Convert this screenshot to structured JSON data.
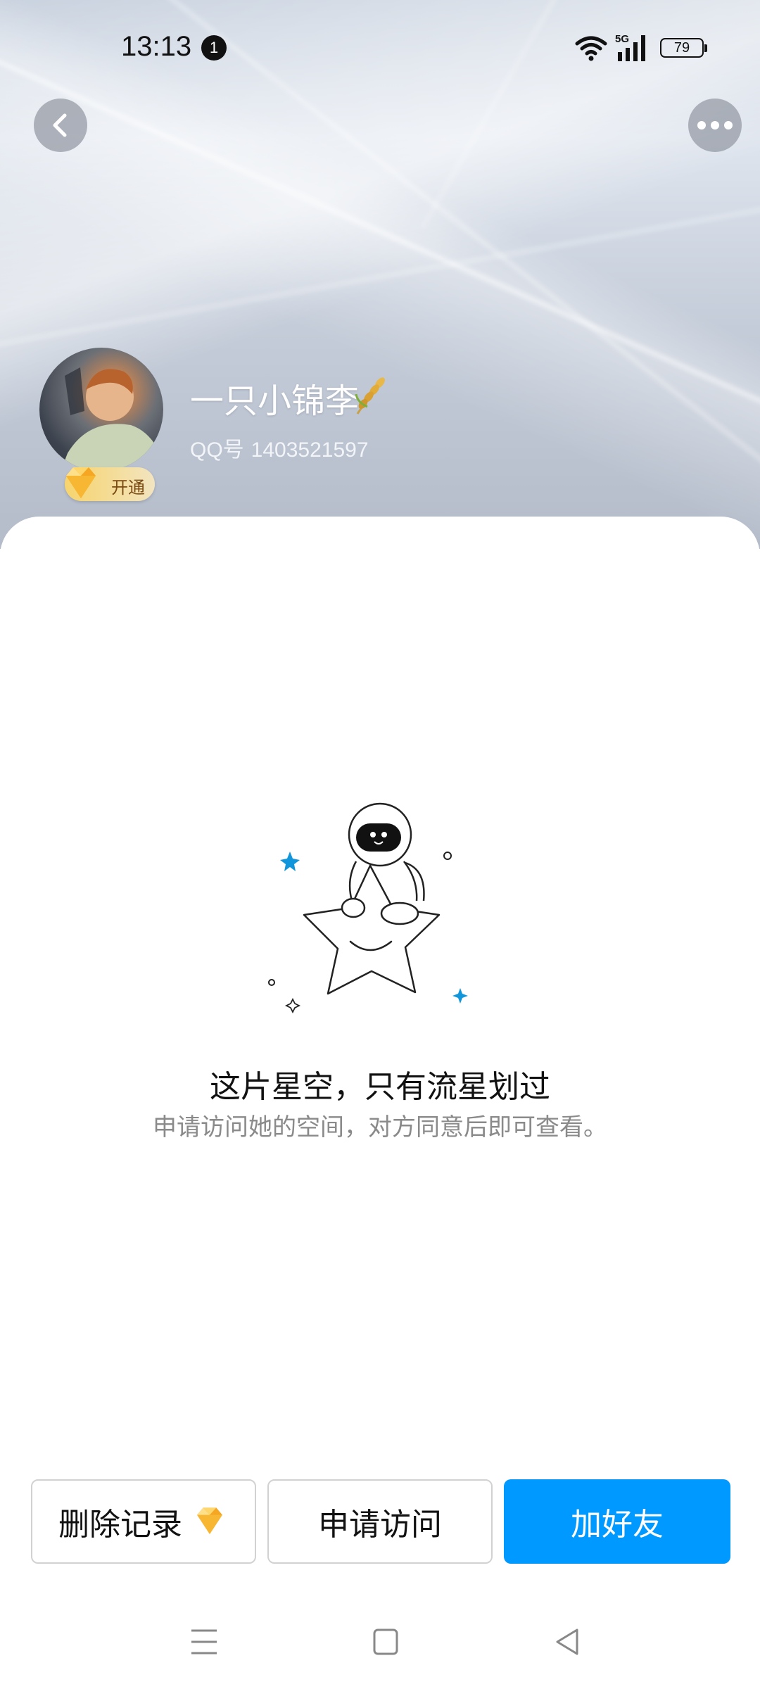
{
  "status_bar": {
    "time": "13:13",
    "notification_count": "1",
    "network": "5G",
    "battery": "79"
  },
  "profile": {
    "nickname": "一只小锦李",
    "qq_label": "QQ号",
    "qq_number": "1403521597",
    "vip_badge": "开通"
  },
  "empty_state": {
    "title": "这片星空，只有流星划过",
    "description": "申请访问她的空间，对方同意后即可查看。"
  },
  "actions": {
    "delete_record": "删除记录",
    "apply_access": "申请访问",
    "add_friend": "加好友"
  },
  "colors": {
    "primary": "#0099ff",
    "star_accent": "#1296db"
  }
}
